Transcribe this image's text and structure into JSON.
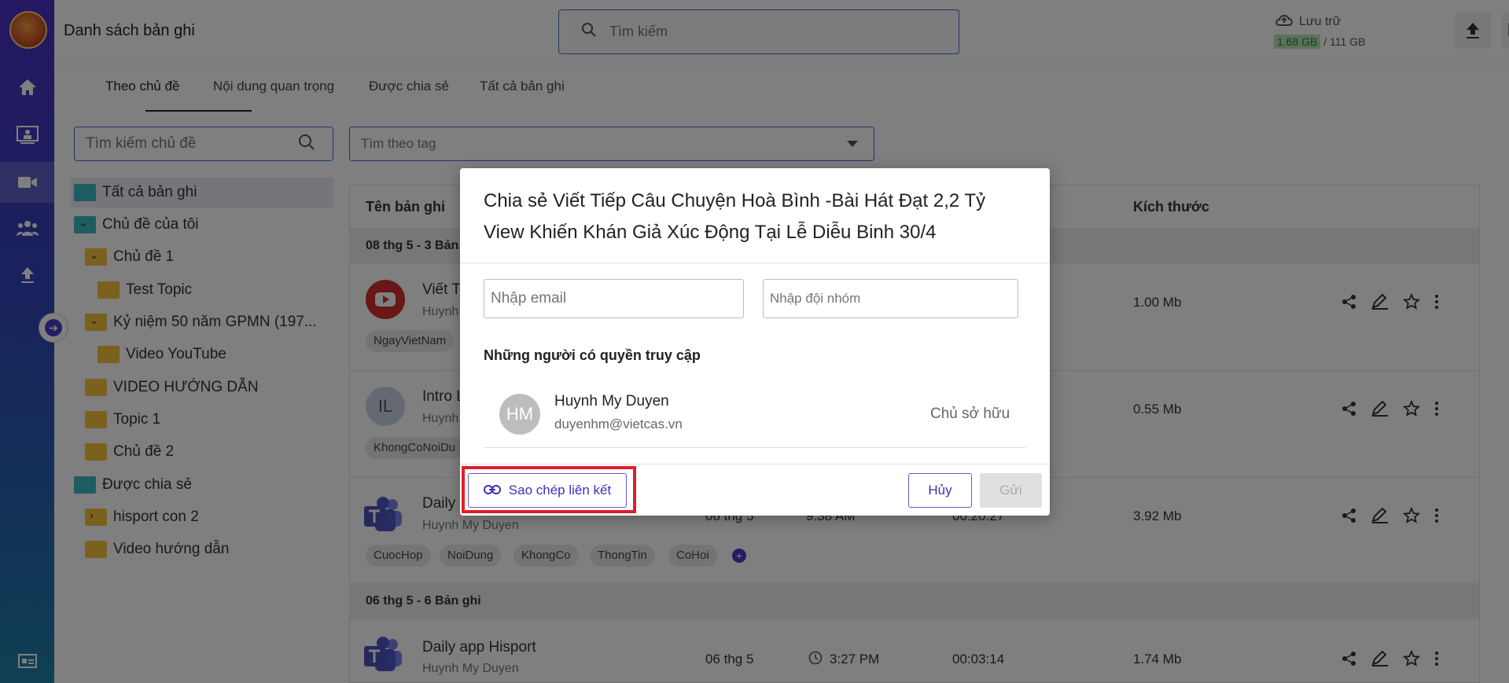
{
  "app": {
    "title": "Danh sách bản ghi"
  },
  "search": {
    "placeholder": "Tìm kiếm"
  },
  "storage": {
    "label": "Lưu trữ",
    "used": "1.68 GB",
    "total": "/ 111 GB"
  },
  "user": {
    "initials": "HM"
  },
  "tabs": [
    {
      "label": "Theo chủ đề"
    },
    {
      "label": "Nội dung quan trọng"
    },
    {
      "label": "Được chia sẻ"
    },
    {
      "label": "Tất cả bản ghi"
    }
  ],
  "filters": {
    "topic_placeholder": "Tìm kiếm chủ đề",
    "tag_placeholder": "Tìm theo tag"
  },
  "tree": [
    {
      "label": "Tất cả bản ghi"
    },
    {
      "label": "Chủ đề của tôi"
    },
    {
      "label": "Chủ đề 1"
    },
    {
      "label": "Test Topic"
    },
    {
      "label": "Kỷ niệm 50 năm GPMN (197..."
    },
    {
      "label": "Video YouTube"
    },
    {
      "label": "VIDEO HƯỚNG DẪN"
    },
    {
      "label": "Topic 1"
    },
    {
      "label": "Chủ đề 2"
    },
    {
      "label": "Được chia sẻ"
    },
    {
      "label": "hisport con 2"
    },
    {
      "label": "Video hướng dẫn"
    }
  ],
  "table": {
    "col_name": "Tên bản ghi",
    "col_size": "Kích thước",
    "groups": [
      {
        "label": "08 thg 5 - 3 Bản"
      },
      {
        "label": "06 thg 5 - 6 Bản ghi"
      }
    ],
    "rows": [
      {
        "title": "Viết T",
        "owner": "Huynh",
        "size": "1.00 Mb",
        "tags": [
          "NgayVietNam"
        ]
      },
      {
        "title": "Intro L",
        "owner": "Huynh",
        "size": "0.55 Mb",
        "tags": [
          "KhongCoNoiDu"
        ],
        "avatar": "IL"
      },
      {
        "title": "Daily a",
        "owner": "Huynh My Duyen",
        "date": "06 thg 5",
        "time": "9:38 AM",
        "duration": "00:20:27",
        "size": "3.92 Mb",
        "tags": [
          "CuocHop",
          "NoiDung",
          "KhongCo",
          "ThongTin",
          "CoHoi"
        ]
      },
      {
        "title": "Daily app Hisport",
        "owner": "Huynh My Duyen",
        "date": "06 thg 5",
        "time": "3:27 PM",
        "duration": "00:03:14",
        "size": "1.74 Mb"
      }
    ]
  },
  "dialog": {
    "title": "Chia sẻ Viết Tiếp Câu Chuyện Hoà Bình -Bài Hát Đạt 2,2 Tỷ View Khiến Khán Giả Xúc Động Tại Lễ Diễu Binh 30/4",
    "email_placeholder": "Nhập email",
    "team_placeholder": "Nhập đội nhóm",
    "access_title": "Những người có quyền truy cập",
    "member": {
      "initials": "HM",
      "name": "Huynh My Duyen",
      "email": "duyenhm@vietcas.vn",
      "role": "Chủ sở hữu"
    },
    "copy_link": "Sao chép liên kết",
    "cancel": "Hủy",
    "send": "Gửi"
  },
  "colors": {
    "accent": "#4b3bc6",
    "highlight": "#e01e2d",
    "folder": "#f5c33b",
    "folder_teal": "#3fb8c4"
  }
}
